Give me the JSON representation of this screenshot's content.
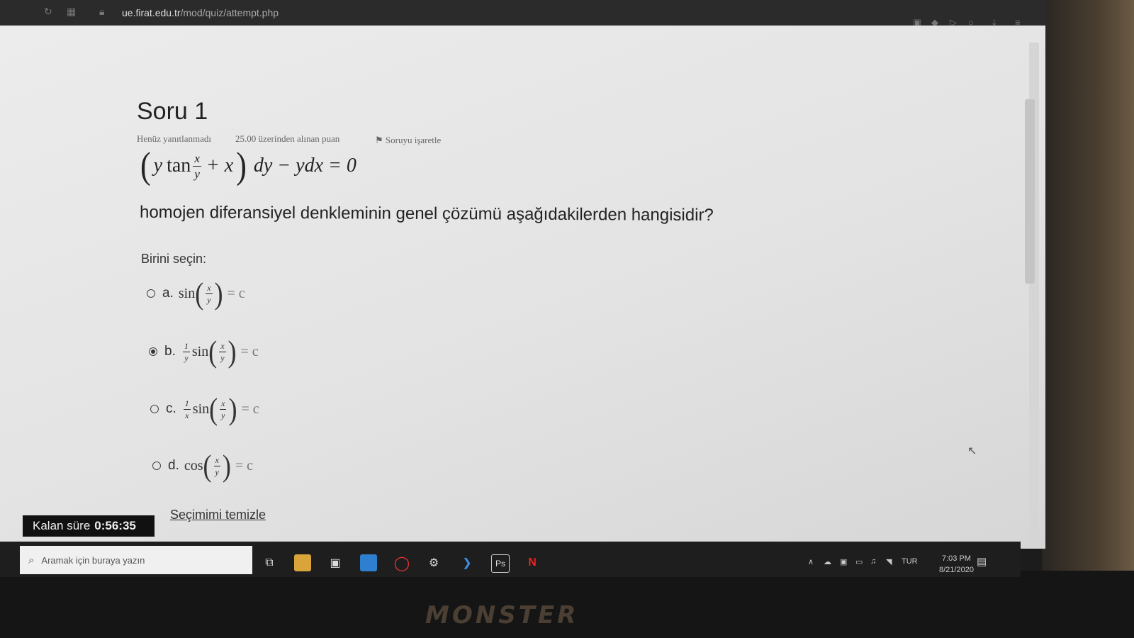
{
  "browser": {
    "url_host": "ue.firat.edu.tr",
    "url_path": "/mod/quiz/attempt.php"
  },
  "question": {
    "title": "Soru 1",
    "status": "Henüz yanıtlanmadı",
    "points": "25.00 üzerinden alınan puan",
    "flag_label": "Soruyu işaretle",
    "equation": {
      "lparen": "(",
      "y": "y",
      "tan": "tan",
      "num": "x",
      "den": "y",
      "plus_x": "+ x",
      "rparen": ")",
      "rest": "dy − ydx = 0"
    },
    "prompt": "homojen diferansiyel denkleminin genel çözümü aşağıdakilerden hangisidir?",
    "choose_label": "Birini seçin:",
    "options": [
      {
        "letter": "a.",
        "coef_num": "",
        "coef_den": "",
        "fn": "sin",
        "num": "x",
        "den": "y",
        "rhs": "= c",
        "selected": false
      },
      {
        "letter": "b.",
        "coef_num": "1",
        "coef_den": "y",
        "fn": "sin",
        "num": "x",
        "den": "y",
        "rhs": "= c",
        "selected": true
      },
      {
        "letter": "c.",
        "coef_num": "1",
        "coef_den": "x",
        "fn": "sin",
        "num": "x",
        "den": "y",
        "rhs": "= c",
        "selected": false
      },
      {
        "letter": "d.",
        "coef_num": "",
        "coef_den": "",
        "fn": "cos",
        "num": "x",
        "den": "y",
        "rhs": "= c",
        "selected": false
      }
    ],
    "clear_label": "Seçimimi temizle"
  },
  "timer": {
    "label": "Kalan süre",
    "value": "0:56:35"
  },
  "taskbar": {
    "search_placeholder": "Aramak için buraya yazın",
    "ps_label": "Ps",
    "netflix_label": "N",
    "lang": "TUR",
    "time": "7:03 PM",
    "date": "8/21/2020"
  },
  "brand": "MONSTER"
}
